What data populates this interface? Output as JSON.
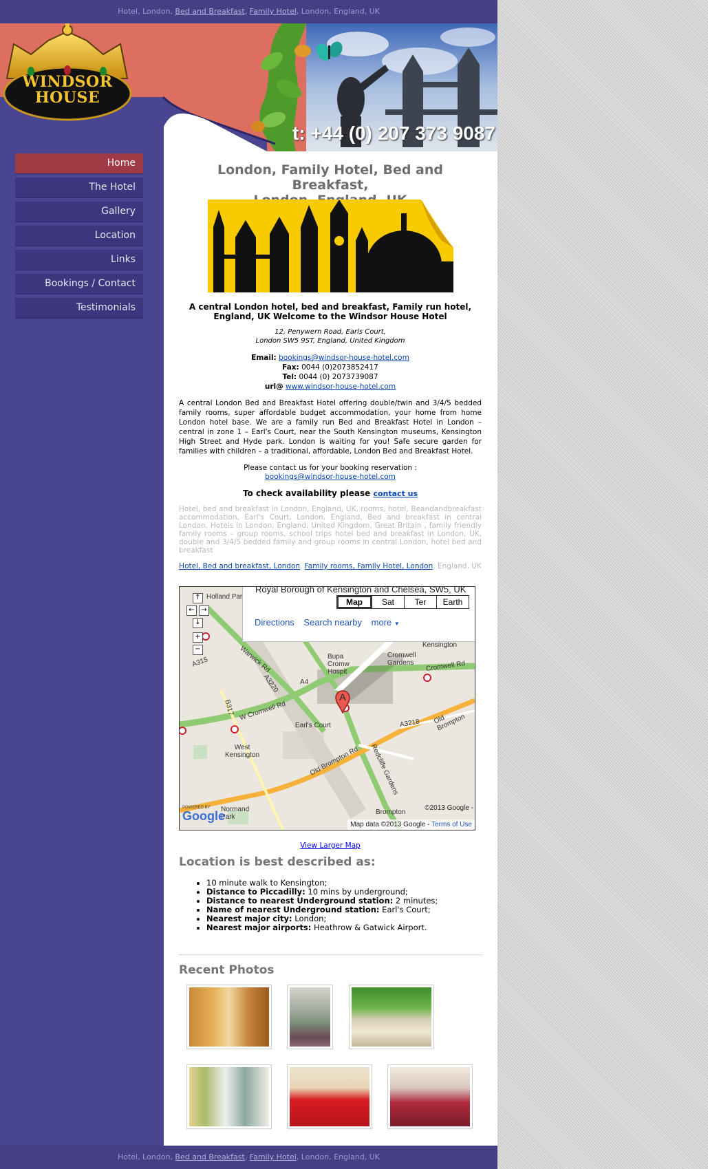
{
  "topbar": {
    "pre": "Hotel, London, ",
    "link1": "Bed and Breakfast",
    "sep": ", ",
    "link2": "Family Hotel",
    "post": ", London, England, UK"
  },
  "header": {
    "logo_line1": "WINDSOR",
    "logo_line2": "HOUSE",
    "phone": "t: +44 (0) 207 373 9087"
  },
  "nav": {
    "items": [
      {
        "label": "Home"
      },
      {
        "label": "The Hotel"
      },
      {
        "label": "Gallery"
      },
      {
        "label": "Location"
      },
      {
        "label": "Links"
      },
      {
        "label": "Bookings / Contact"
      },
      {
        "label": "Testimonials"
      }
    ]
  },
  "main": {
    "title_line1": "London, Family Hotel, Bed and Breakfast,",
    "title_line2": "London, England, UK",
    "tagline": "A central London hotel, bed and breakfast, Family run hotel, England, UK Welcome to the Windsor House Hotel",
    "address_line1": "12, Penywern Road, Earls Court,",
    "address_line2": "London SW5 9ST, England, United Kingdom",
    "email_label": "Email:",
    "email": "bookings@windsor-house-hotel.com",
    "fax_label": "Fax:",
    "fax": "0044 (0)2073852417",
    "tel_label": "Tel:",
    "tel": "0044 (0) 2073739087",
    "url_label": "url@",
    "url": "www.windsor-house-hotel.com",
    "paragraph": "A central London Bed and Breakfast Hotel offering double/twin and 3/4/5 bedded family rooms, super affordable budget accommodation, your home from home London hotel base. We are a family run Bed and Breakfast Hotel in London – central in zone 1 – Earl's Court, near the South Kensington museums, Kensington High Street and Hyde park. London is waiting for you! Safe secure garden for families with children – a traditional, affordable, London Bed and Breakfast Hotel.",
    "booking_text": "Please contact us for your booking reservation :",
    "booking_email": "bookings@windsor-house-hotel.com",
    "avail_text": "To check availability please",
    "avail_link": "contact us",
    "seo_text": "Hotel, bed and breakfast in London, England, UK, rooms, hotel, Beandandbreakfast accommodation, Earl's Court, London, England, Bed and breakfast in central London, Hotels in London, England, United Kingdom, Great Britain , family friendly family rooms – group rooms, school trips hotel bed and breakfast in London, UK, double and 3/4/5 bedded family and group rooms in central London, hotel bed and breakfast",
    "seo_link1": "Hotel, Bed and breakfast, London",
    "seo_sep": ",",
    "seo_link2": "Family rooms, Family Hotel, London",
    "seo_tail": ", England, UK",
    "view_larger_map": "View Larger Map",
    "location_heading": "Location is best described as:",
    "location_items": [
      {
        "label": "",
        "value": "10 minute walk to Kensington;"
      },
      {
        "label": "Distance to Piccadilly:",
        "value": "10 mins by underground;"
      },
      {
        "label": "Distance to nearest Underground station:",
        "value": "2 minutes;"
      },
      {
        "label": "Name of nearest Underground station:",
        "value": "Earl's Court;"
      },
      {
        "label": "Nearest major city:",
        "value": "London;"
      },
      {
        "label": "Nearest major airports:",
        "value": "Heathrow & Gatwick Airport."
      }
    ],
    "photos_heading": "Recent Photos"
  },
  "map": {
    "info_title": "Royal Borough of Kensington and Chelsea, SW5, UK",
    "types": [
      "Map",
      "Sat",
      "Ter",
      "Earth"
    ],
    "directions": "Directions",
    "search_nearby": "Search nearby",
    "more": "more",
    "marker": "A",
    "labels": {
      "holland_park": "Holland Par",
      "kensington": "Kensington",
      "cromwell_gardens": "Cromwell Gardens",
      "bupa": "Bupa Cromw Hospit",
      "cromwell_rd": "Cromwell Rd",
      "warwick_rd": "Warwick Rd",
      "a3220": "A3220",
      "a4": "A4",
      "a315": "A315",
      "b317": "B317",
      "w_cromwell_rd": "W Cromwell Rd",
      "earls_court": "Earl's Court",
      "west_kensington": "West Kensington",
      "old_brompton_rd": "Old Brompton Rd",
      "a3218": "A3218",
      "old_brompton": "Old Brompton",
      "redcliffe_gardens": "Redcliffe Gardens",
      "normand_park": "Normand Park",
      "brompton": "Brompton",
      "powered_by": "POWERED BY",
      "google": "Google",
      "copyright": "©2013 Google -",
      "map_data": "Map data ©2013 Google -",
      "terms": "Terms of Use"
    }
  },
  "colors": {
    "page_bg": "#4a4590",
    "nav_item": "#3b367d",
    "nav_active": "#9f3a45",
    "link": "#0645ad",
    "header_bg": "#d9695d"
  },
  "footbar": {
    "pre": "Hotel, London, ",
    "link1": "Bed and Breakfast",
    "sep": ", ",
    "link2": "Family Hotel",
    "post": ", London, England, UK"
  }
}
